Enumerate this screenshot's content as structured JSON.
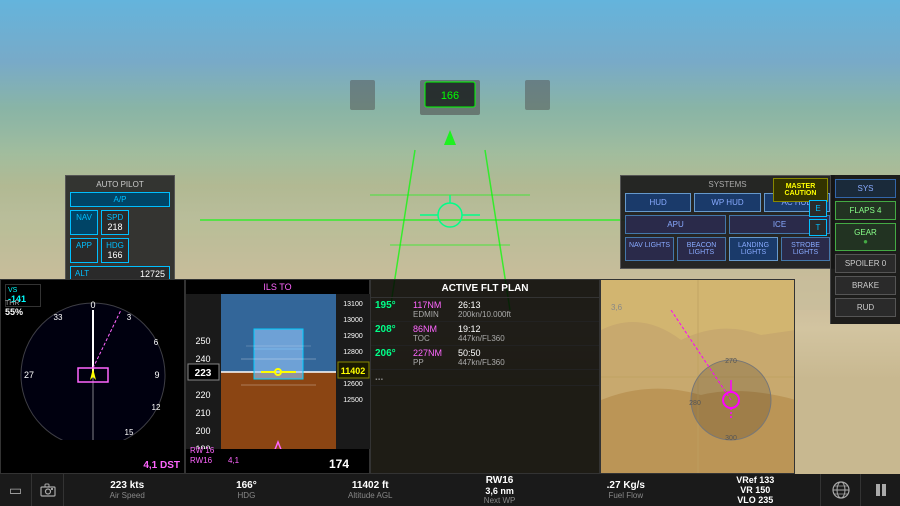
{
  "background": {
    "sky_color": "#87CEEB",
    "terrain_color": "#8FBC8F"
  },
  "autopilot": {
    "title": "AUTO PILOT",
    "ap_label": "A/P",
    "nav_label": "NAV",
    "spd_label": "SPD",
    "spd_value": "218",
    "app_label": "APP",
    "hdg_label": "HDG",
    "hdg_value": "166",
    "alt_label": "ALT",
    "alt_value": "12725"
  },
  "left_instrument": {
    "vs_label": "VS",
    "vs_value": "-141",
    "thr_label": "THR",
    "thr_value": "55%",
    "runway_label": "RW16",
    "dist_label": "4,1 DST",
    "speed_kts": "223 kts",
    "speed_sub": "Air Speed"
  },
  "middle_instrument": {
    "ils_label": "ILS TO",
    "alt_value": "223",
    "rwy_top": "RW 16",
    "rwy_bot": "RW16",
    "approach_dist": "4,1",
    "heading_val": "174",
    "hdg_label": "166°",
    "hdg_sub": "HDG"
  },
  "alt_display": {
    "value": "11 402 ft",
    "sub": "Altitude AGL"
  },
  "flight_plan": {
    "title": "ACTIVE FLT PLAN",
    "rows": [
      {
        "hdg": "195°",
        "wp": "EDMIN",
        "dist": "117NM",
        "time": "26:13",
        "sub": "200kn/10.000ft"
      },
      {
        "hdg": "208°",
        "wp": "TOC",
        "dist": "86NM",
        "time": "19:12",
        "sub": "447kn/FL360"
      },
      {
        "hdg": "206°",
        "wp": "PP",
        "dist": "227NM",
        "time": "50:50",
        "sub": "447kn/FL360"
      },
      {
        "hdg": "...",
        "wp": "",
        "dist": "",
        "time": "",
        "sub": ""
      }
    ]
  },
  "next_wp": {
    "value": "RW16",
    "dist": "3,6 nm",
    "sub": "Next WP"
  },
  "fuel_flow": {
    "value": ".27 Kg/s",
    "sub": "Fuel Flow"
  },
  "vref": {
    "line1": "VRef 133",
    "line2": "VR 150",
    "line3": "VLO 235"
  },
  "systems": {
    "title": "SYSTEMS",
    "buttons": [
      [
        "HUD",
        "WP HUD",
        "AC HUD"
      ],
      [
        "APU",
        "ICE"
      ],
      [
        "NAV LIGHTS",
        "BEACON LIGHTS",
        "LANDING LIGHTS",
        "STROBE LIGHTS"
      ]
    ]
  },
  "right_panel": {
    "master_caution": "MASTER CAUTION",
    "sys_label": "SYS",
    "et_label": "E T",
    "flaps_label": "FLAPS 4",
    "gear_label": "GEAR",
    "spoiler_label": "SPOILER 0",
    "brake_label": "BRAKE",
    "rud_label": "RUD"
  },
  "bottom_toolbar": {
    "icons": [
      "▭",
      "📷"
    ],
    "status_items": [
      {
        "value": "223 kts",
        "label": "Air Speed"
      },
      {
        "value": "166°",
        "label": "HDG"
      },
      {
        "value": "11402 ft",
        "label": "Altitude AGL"
      },
      {
        "value": "RW16\n3,6 nm",
        "label": "Next WP"
      },
      {
        "value": ".27 Kg/s",
        "label": "Fuel Flow"
      },
      {
        "value": "VRef 133\nVR 150\nVLO 235",
        "label": ""
      }
    ],
    "right_icons": [
      "🌐",
      "⏸"
    ]
  },
  "hud": {
    "crosshair_color": "#00ff00",
    "horizon_color": "#00ff00"
  }
}
